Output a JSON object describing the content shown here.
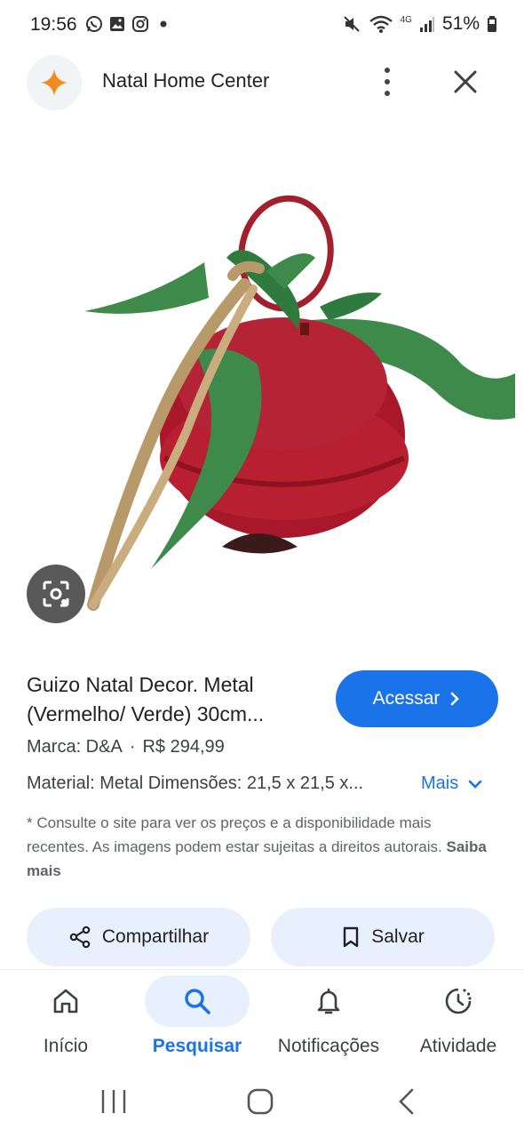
{
  "status_bar": {
    "time": "19:56",
    "battery": "51%",
    "left_icons": [
      "whatsapp-icon",
      "gallery-icon",
      "instagram-icon",
      "dot-icon"
    ],
    "right_icons": [
      "mute-icon",
      "wifi-icon",
      "lte-icon",
      "signal-icon",
      "battery-icon"
    ],
    "network_label": "4G"
  },
  "header": {
    "site_name": "Natal Home Center",
    "logo_color": "#f28b1e"
  },
  "product": {
    "title": "Guizo Natal Decor. Metal (Vermelho/ Verde) 30cm...",
    "cta": "Acessar",
    "brand": "Marca: D&A",
    "separator": "·",
    "price": "R$ 294,99",
    "description": "Material: Metal Dimensões: 21,5 x 21,5 x...",
    "more": "Mais",
    "disclaimer": "* Consulte o site para ver os preços e a disponibilidade mais recentes. As imagens podem estar sujeitas a direitos autorais.",
    "learn_more": "Saiba mais"
  },
  "actions": {
    "share": "Compartilhar",
    "save": "Salvar"
  },
  "bottom_nav": {
    "items": [
      {
        "label": "Início",
        "icon": "home-icon"
      },
      {
        "label": "Pesquisar",
        "icon": "search-icon",
        "active": true
      },
      {
        "label": "Notificações",
        "icon": "bell-icon"
      },
      {
        "label": "Atividade",
        "icon": "activity-icon"
      }
    ]
  },
  "colors": {
    "accent": "#1a73e8",
    "pill_bg": "#e8f0fe",
    "bell_red": "#a8182a",
    "ribbon_green": "#3d8a4a"
  }
}
